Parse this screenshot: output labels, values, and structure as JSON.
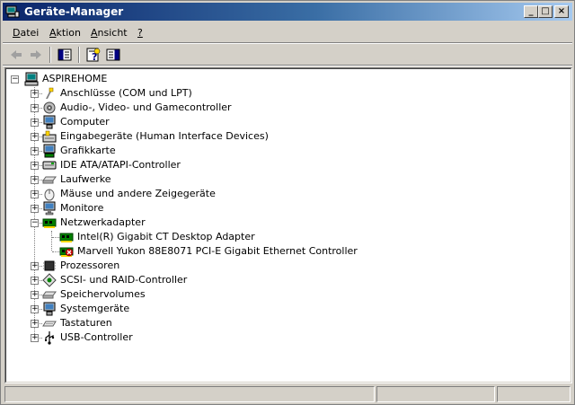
{
  "window": {
    "title": "Geräte-Manager",
    "minimize": "_",
    "maximize": "□",
    "close": "×"
  },
  "menu": [
    {
      "label": "Datei",
      "accel": "D",
      "rest": "atei"
    },
    {
      "label": "Aktion",
      "accel": "A",
      "rest": "ktion"
    },
    {
      "label": "Ansicht",
      "accel": "A",
      "rest": "nsicht"
    },
    {
      "label": "?",
      "accel": "?",
      "rest": ""
    }
  ],
  "toolbar": [
    "back-arrow-icon",
    "forward-arrow-icon",
    "show-hide-console-tree-icon",
    "help-properties-icon",
    "show-hide-action-pane-icon"
  ],
  "tree": {
    "root": "ASPIREHOME",
    "items": [
      {
        "label": "Anschlüsse (COM und LPT)",
        "icon": "port-icon",
        "expanded": false
      },
      {
        "label": "Audio-, Video- und Gamecontroller",
        "icon": "audio-icon",
        "expanded": false
      },
      {
        "label": "Computer",
        "icon": "computer-icon",
        "expanded": false
      },
      {
        "label": "Eingabegeräte (Human Interface Devices)",
        "icon": "hid-icon",
        "expanded": false
      },
      {
        "label": "Grafikkarte",
        "icon": "display-adapter-icon",
        "expanded": false
      },
      {
        "label": "IDE ATA/ATAPI-Controller",
        "icon": "ide-controller-icon",
        "expanded": false
      },
      {
        "label": "Laufwerke",
        "icon": "disk-drive-icon",
        "expanded": false
      },
      {
        "label": "Mäuse und andere Zeigegeräte",
        "icon": "mouse-icon",
        "expanded": false
      },
      {
        "label": "Monitore",
        "icon": "monitor-icon",
        "expanded": false
      },
      {
        "label": "Netzwerkadapter",
        "icon": "network-adapter-icon",
        "expanded": true,
        "children": [
          {
            "label": "Intel(R) Gigabit CT Desktop Adapter",
            "icon": "network-card-icon"
          },
          {
            "label": "Marvell Yukon 88E8071 PCI-E Gigabit Ethernet Controller",
            "icon": "network-card-error-icon"
          }
        ]
      },
      {
        "label": "Prozessoren",
        "icon": "processor-icon",
        "expanded": false
      },
      {
        "label": "SCSI- und RAID-Controller",
        "icon": "scsi-icon",
        "expanded": false
      },
      {
        "label": "Speichervolumes",
        "icon": "storage-volume-icon",
        "expanded": false
      },
      {
        "label": "Systemgeräte",
        "icon": "system-device-icon",
        "expanded": false
      },
      {
        "label": "Tastaturen",
        "icon": "keyboard-icon",
        "expanded": false
      },
      {
        "label": "USB-Controller",
        "icon": "usb-icon",
        "expanded": false
      }
    ]
  },
  "colors": {
    "titlebar_start": "#0a246a",
    "titlebar_end": "#a6caf0",
    "chrome": "#d4d0c8"
  }
}
